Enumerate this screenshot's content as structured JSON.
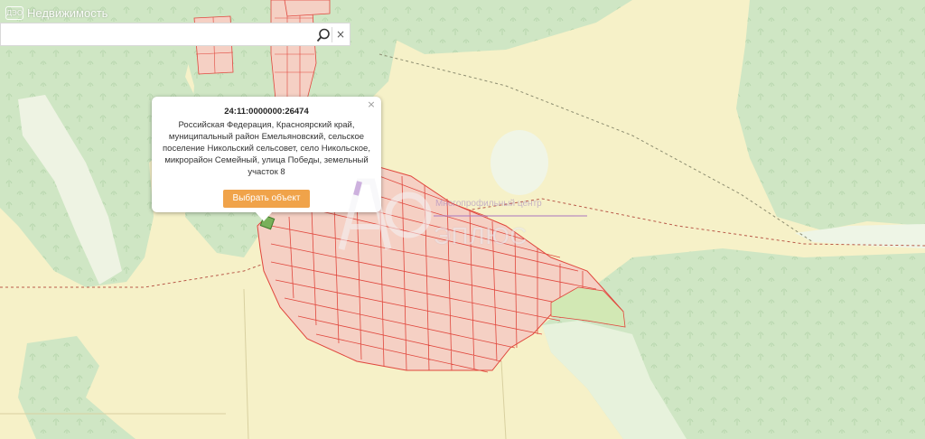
{
  "brand": {
    "icon_text": "ДЭО",
    "label": "Недвижимость"
  },
  "search": {
    "value": "",
    "placeholder": ""
  },
  "popup": {
    "cadastral_number": "24:11:0000000:26474",
    "address": "Российская Федерация, Красноярский край, муниципальный район Емельяновский, сельское поселение Никольский сельсовет, село Никольское, микрорайон Семейный, улица Победы, земельный участок 8",
    "select_button": "Выбрать объект",
    "close_glyph": "×"
  },
  "search_icon_name": "search-icon",
  "clear_glyph": "×",
  "watermark": {
    "top_text": "Многопрофильный центр",
    "main_text": "ЭПЛЮС",
    "sub_text": ""
  },
  "colors": {
    "field": "#f6f1c8",
    "forest": "#cfe6c4",
    "river_meadow": "#e7f2dc",
    "parcel_fill": "#f5d0c4",
    "parcel_stroke": "#e0473d",
    "green_parcel": "#d2e8b4",
    "selected_parcel": "#78b05a",
    "popup_button": "#f0a34a"
  }
}
